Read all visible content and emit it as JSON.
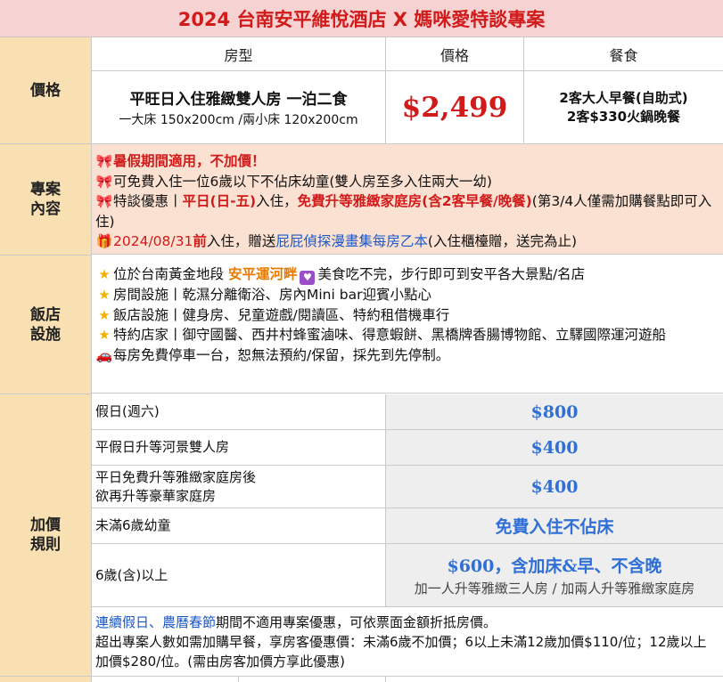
{
  "title": "2024 台南安平維悅酒店 X 媽咪愛特談專案",
  "price_section": {
    "label": "價格",
    "headers": {
      "room": "房型",
      "price": "價格",
      "meal": "餐食"
    },
    "room_name": "平旺日入住雅緻雙人房 一泊二食",
    "room_beds": "一大床  150x200cm /兩小床 120x200cm",
    "price": "$2,499",
    "meal_line1": "2客大人早餐(自助式)",
    "meal_line2": "2客$330火鍋晚餐"
  },
  "plan_section": {
    "label_line1": "專案",
    "label_line2": "內容",
    "line1": "暑假期間適用，不加價！",
    "line2": "可免費入住一位6歲以下不佔床幼童(雙人房至多入住兩大一幼)",
    "line3_a": "特談優惠丨",
    "line3_b": "平日(日-五)",
    "line3_c": "入住，",
    "line3_d": "免費升等雅緻家庭房(含2客早餐/晚餐)",
    "line3_e": "(第3/4人僅需加購餐點即可入住)",
    "line4_a": "2024/08/31",
    "line4_b": "前",
    "line4_c": "入住，贈送",
    "line4_d": "屁屁偵探漫畫集每房乙本",
    "line4_e": "(入住櫃檯贈，送完為止)"
  },
  "facility_section": {
    "label_line1": "飯店",
    "label_line2": "設施",
    "line1_a": "位於台南黃金地段 ",
    "line1_b": "安平運河畔",
    "line1_c": "美食吃不完，步行即可到安平各大景點/名店",
    "line2": "房間設施丨乾濕分離衛浴、房內Mini bar迎賓小點心",
    "line3": "飯店設施丨健身房、兒童遊戲/閱讀區、特約租借機車行",
    "line4": "特約店家丨御守國醫、西井村蜂蜜滷味、得意蝦餅、黑橋牌香腸博物館、立驛國際運河遊船",
    "line5": "每房免費停車一台，恕無法預約/保留，採先到先停制。"
  },
  "surcharge_section": {
    "label_line1": "加價",
    "label_line2": "規則",
    "rows": [
      {
        "label": "假日(週六)",
        "value": "$800"
      },
      {
        "label": "平假日升等河景雙人房",
        "value": "$400"
      },
      {
        "label_line1": "平日免費升等雅緻家庭房後",
        "label_line2": "欲再升等豪華家庭房",
        "value": "$400"
      },
      {
        "label": "未滿6歲幼童",
        "value": "免費入住不佔床"
      },
      {
        "label": "6歲(含)以上",
        "value": "$600，含加床&早、不含晚",
        "sub": "加一人升等雅緻三人房 / 加兩人升等雅緻家庭房"
      }
    ],
    "note_a": "連續假日、農曆春節",
    "note_b": "期間不適用專案優惠，可依票面金額折抵房價。",
    "note_c": "超出專案人數如需加購早餐，享房客優惠價：未滿6歲不加價；6以上未滿12歲加價$110/位；12歲以上加價$280/位。(需由房客加價方享此優惠)"
  },
  "icons": {
    "bow": "ribbon-bow-icon",
    "gift": "gift-icon",
    "star": "star-icon",
    "heart": "heart-icon",
    "car": "car-icon"
  },
  "colors": {
    "title_bg": "#f7d2d2",
    "label_bg": "#f9e0b3",
    "plan_bg": "#fbe1d1",
    "accent_red": "#d11a1a",
    "accent_blue": "#2f6fd6"
  }
}
